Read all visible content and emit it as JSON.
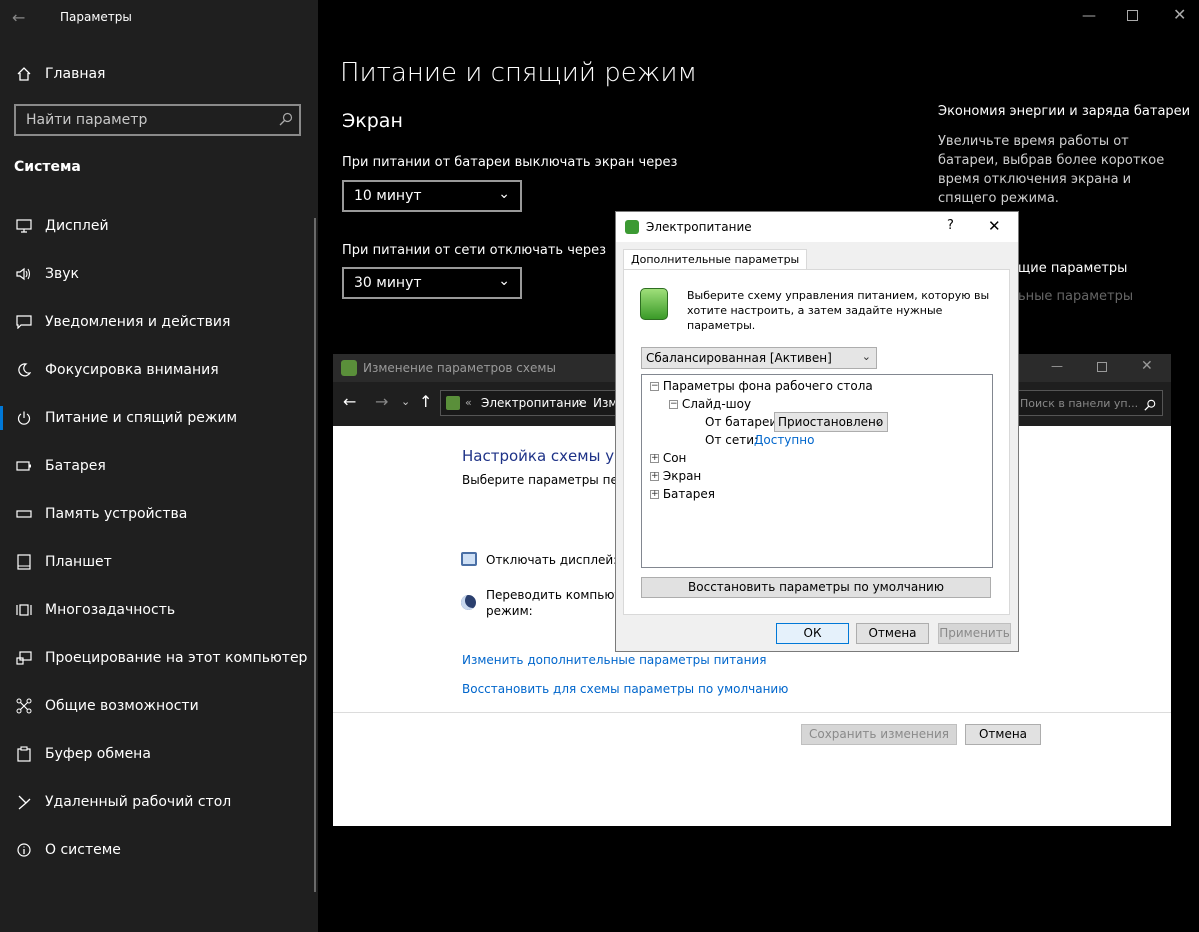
{
  "app": {
    "title": "Параметры"
  },
  "sidebar": {
    "home": "Главная",
    "search_placeholder": "Найти параметр",
    "section": "Система",
    "items": [
      {
        "label": "Дисплей",
        "icon": "display-icon"
      },
      {
        "label": "Звук",
        "icon": "sound-icon"
      },
      {
        "label": "Уведомления и действия",
        "icon": "notifications-icon"
      },
      {
        "label": "Фокусировка внимания",
        "icon": "moon-icon"
      },
      {
        "label": "Питание и спящий режим",
        "icon": "power-icon"
      },
      {
        "label": "Батарея",
        "icon": "battery-icon"
      },
      {
        "label": "Память устройства",
        "icon": "storage-icon"
      },
      {
        "label": "Планшет",
        "icon": "tablet-icon"
      },
      {
        "label": "Многозадачность",
        "icon": "multitask-icon"
      },
      {
        "label": "Проецирование на этот компьютер",
        "icon": "project-icon"
      },
      {
        "label": "Общие возможности",
        "icon": "shared-icon"
      },
      {
        "label": "Буфер обмена",
        "icon": "clipboard-icon"
      },
      {
        "label": "Удаленный рабочий стол",
        "icon": "remote-icon"
      },
      {
        "label": "О системе",
        "icon": "info-icon"
      }
    ]
  },
  "main": {
    "title": "Питание и спящий режим",
    "section": "Экран",
    "battery_label": "При питании от батареи выключать экран через",
    "battery_value": "10 минут",
    "ac_label": "При питании от сети отключать через",
    "ac_value": "30 минут",
    "side_title": "Экономия энергии и заряда батареи",
    "side_text": "Увеличьте время работы от батареи, выбрав более короткое время отключения экрана и спящего режима.",
    "related_title": "щие параметры",
    "related_link": "ьные параметры"
  },
  "cpwin": {
    "title": "Изменение параметров схемы",
    "breadcrumb_sep": "«",
    "breadcrumb_1": "Электропитание",
    "breadcrumb_sep2": "›",
    "breadcrumb_2": "Изм",
    "search_placeholder": "Поиск в панели уп...",
    "heading": "Настройка схемы упр",
    "subheading": "Выберите параметры перев",
    "display_label": "Отключать дисплей:",
    "sleep_label_1": "Переводить компьютер",
    "sleep_label_2": "режим:",
    "link_advanced": "Изменить дополнительные параметры питания",
    "link_restore": "Восстановить для схемы параметры по умолчанию",
    "save_btn": "Сохранить изменения",
    "cancel_btn": "Отмена"
  },
  "dialog": {
    "title": "Электропитание",
    "help": "?",
    "tab": "Дополнительные параметры",
    "intro": "Выберите схему управления питанием, которую вы хотите настроить, а затем задайте нужные параметры.",
    "scheme": "Сбалансированная [Активен]",
    "tree": {
      "n1": "Параметры фона рабочего стола",
      "n2": "Слайд-шоу",
      "battery_label": "От батареи:",
      "battery_value": "Приостановлено",
      "ac_label": "От сети:",
      "ac_value": "Доступно",
      "sleep": "Сон",
      "screen": "Экран",
      "battery": "Батарея"
    },
    "restore_btn": "Восстановить параметры по умолчанию",
    "ok": "ОК",
    "cancel": "Отмена",
    "apply": "Применить"
  },
  "colors": {
    "accent": "#0066cc",
    "sidebar": "#1f1f1f",
    "selected_bar": "#0078d7"
  }
}
